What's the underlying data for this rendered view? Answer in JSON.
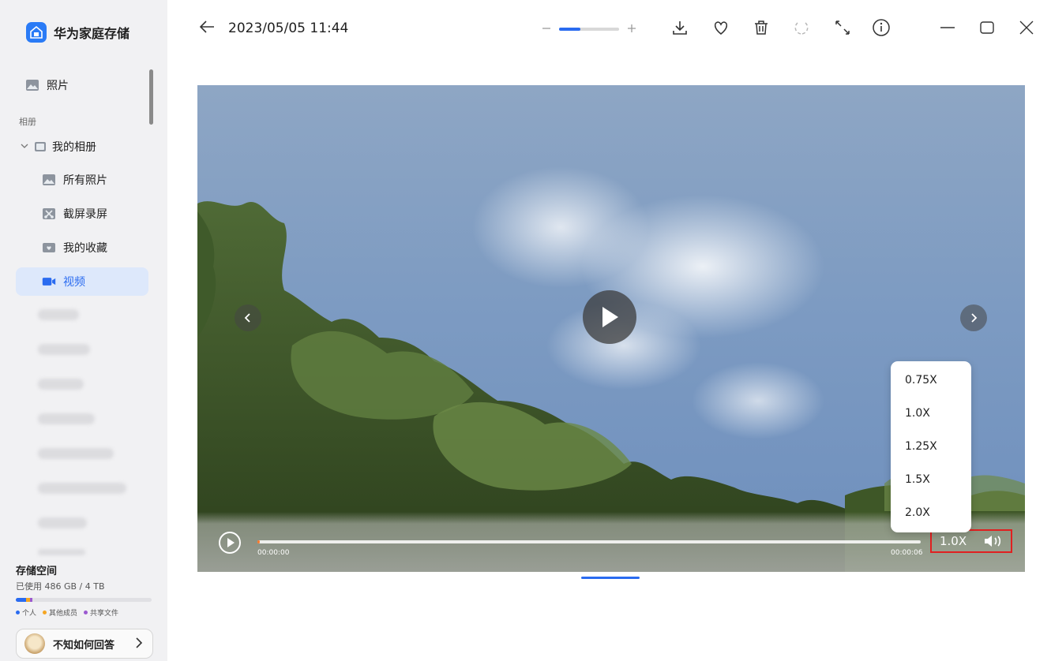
{
  "app": {
    "title": "华为家庭存储"
  },
  "sidebar": {
    "photos_label": "照片",
    "albums_section": "相册",
    "my_albums": "我的相册",
    "items": [
      {
        "label": "所有照片",
        "icon": "photo-icon"
      },
      {
        "label": "截屏录屏",
        "icon": "scissors-icon"
      },
      {
        "label": "我的收藏",
        "icon": "favorite-album-icon"
      },
      {
        "label": "视频",
        "icon": "video-icon",
        "active": true
      }
    ]
  },
  "storage": {
    "title": "存储空间",
    "used_text": "已使用 486 GB / 4 TB",
    "used_fraction": 0.12,
    "legend": [
      {
        "label": "个人",
        "color": "#2a6bf0"
      },
      {
        "label": "其他成员",
        "color": "#f5a623"
      },
      {
        "label": "共享文件",
        "color": "#9b59d0"
      }
    ]
  },
  "user": {
    "name": "不知如何回答"
  },
  "toolbar": {
    "date": "2023/05/05 11:44",
    "zoom_level": 0.35
  },
  "player": {
    "time_start": "00:00:00",
    "time_end": "00:00:06",
    "progress": 0.0,
    "speed": "1.0X",
    "speed_options": [
      "0.75X",
      "1.0X",
      "1.25X",
      "1.5X",
      "2.0X"
    ]
  },
  "colors": {
    "accent": "#2a6bf0",
    "active_bg": "#dde8fb",
    "highlight": "#e02020"
  }
}
